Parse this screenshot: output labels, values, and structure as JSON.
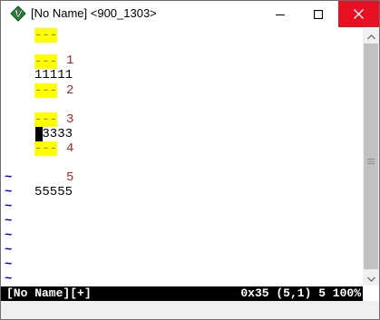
{
  "window": {
    "title": "[No Name] <900_1303>",
    "icon": "gvim-icon",
    "controls": [
      "minimize-icon",
      "maximize-icon",
      "close-icon"
    ],
    "close_color": "#e81123"
  },
  "editor": {
    "virtual_text": "---",
    "virtual_text_background": "#ffff00",
    "line_number_color": "#a52a2a",
    "tilde_color": "#0000ff",
    "lines": [
      {
        "number": "1",
        "text": "11111"
      },
      {
        "number": "2",
        "text": ""
      },
      {
        "number": "3",
        "text": "33333"
      },
      {
        "number": "4",
        "text": ""
      },
      {
        "number": "5",
        "text": "55555"
      }
    ],
    "tilde": "~"
  },
  "statusline": {
    "file": "[No Name][+]",
    "info": "0x35 (5,1) 5 100%"
  }
}
